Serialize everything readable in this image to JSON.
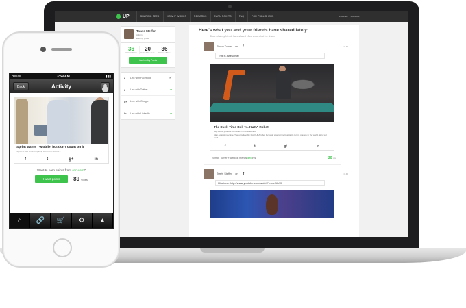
{
  "laptop": {
    "logo": "UP",
    "nav": [
      "SHARING FEED",
      "HOW IT WORKS",
      "REWARDS",
      "EARN POINTS",
      "FAQ",
      "FOR PUBLISHERS"
    ],
    "topbar_right": [
      "PROFILE",
      "SIGN OUT"
    ],
    "profile": {
      "name": "Travis Steffen",
      "role": "Admin",
      "edit": "Edit my profile"
    },
    "stats": [
      {
        "value": "36",
        "label": "Current Points"
      },
      {
        "value": "20",
        "label": "Earned this week"
      },
      {
        "value": "36",
        "label": "Earned all time"
      }
    ],
    "cash_button": "Cash In My Points",
    "social_links": [
      {
        "icon": "f",
        "label": "Link with Facebook",
        "action": "✓"
      },
      {
        "icon": "t",
        "label": "Link with Twitter",
        "action": "+"
      },
      {
        "icon": "g+",
        "label": "Link with Google+",
        "action": "+"
      },
      {
        "icon": "in",
        "label": "Link with LinkedIn",
        "action": "+"
      }
    ],
    "feed": {
      "title": "Here's what you and your friends have shared lately:",
      "subtitle": "Show what my friends have shared  |  Just show what I've shared",
      "post1": {
        "user": "Simon Turner",
        "on": "on",
        "network": "f",
        "time": "⊙ 4d",
        "comment": "This is awesome!",
        "share_title": "The Duel: Timo Boll vs. KUKA Robot",
        "share_url": "http://www.youtube.com/watch?v=tIIJME8-au8",
        "share_desc": "Man against machine. The unbelievably fast KUKA robot faces off against the best table tennis players in the world. Who will win?",
        "icons": [
          "f",
          "t",
          "g+",
          "in"
        ]
      },
      "friends_line": {
        "pre": "Simon Turner Facebook friends ",
        "liked": "liked",
        "post": " this",
        "points": "20",
        "points_unit": "pts"
      },
      "post2": {
        "user": "Travis Steffen",
        "on": "on",
        "network": "f",
        "time": "⊙ 4d",
        "comment": "Hilarious. http://www.youtube.com/watch?v=aeI1IzX0"
      }
    }
  },
  "phone": {
    "status": {
      "carrier": "Bellair",
      "time": "3:59 AM",
      "battery": "▮▮▮"
    },
    "header": {
      "back": "Back",
      "title": "Activity"
    },
    "post": {
      "title": "Sprint wants T-Mobile, but don't count on it",
      "subtitle": "Sprint is said to be preparing a bid for T-Mobile...",
      "icons": [
        "f",
        "t",
        "g+",
        "in"
      ]
    },
    "earn": {
      "pre": "Want to earn points from ",
      "source": "cnn.com",
      "post": "?"
    },
    "button": "I want points",
    "votes": {
      "count": "89",
      "label": "votes"
    },
    "tabs": [
      "home-icon",
      "link-icon",
      "cart-icon",
      "gear-icon",
      "up-arrow-icon"
    ]
  }
}
